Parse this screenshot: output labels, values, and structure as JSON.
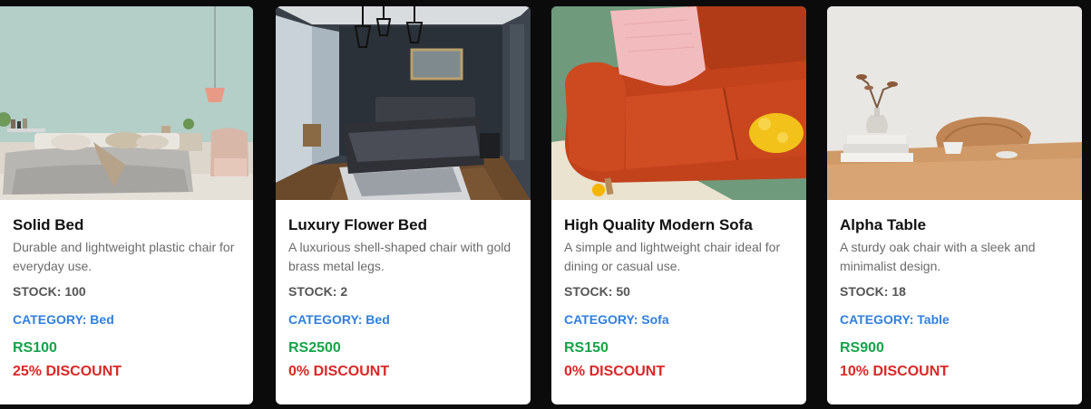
{
  "colors": {
    "page_bg": "#0b0b0b",
    "card_bg": "#ffffff",
    "title": "#111111",
    "description": "#6b6b6b",
    "stock": "#555555",
    "category": "#2f7fde",
    "price": "#16a34a",
    "discount": "#dc2626"
  },
  "products": [
    {
      "name": "Solid Bed",
      "description": "Durable and lightweight plastic chair for everyday use.",
      "stock_label": "STOCK:",
      "stock": "100",
      "category_label": "CATEGORY:",
      "category": "Bed",
      "price": "RS100",
      "discount": "25% DISCOUNT",
      "image": "bedroom-with-grey-bed-photo"
    },
    {
      "name": "Luxury Flower Bed",
      "description": "A luxurious shell-shaped chair with gold brass metal legs.",
      "stock_label": "STOCK:",
      "stock": "2",
      "category_label": "CATEGORY:",
      "category": "Bed",
      "price": "RS2500",
      "discount": "0% DISCOUNT",
      "image": "dark-luxury-bedroom-photo"
    },
    {
      "name": "High Quality Modern Sofa",
      "description": "A simple and lightweight chair ideal for dining or casual use.",
      "stock_label": "STOCK:",
      "stock": "50",
      "category_label": "CATEGORY:",
      "category": "Sofa",
      "price": "RS150",
      "discount": "0% DISCOUNT",
      "image": "orange-sofa-photo"
    },
    {
      "name": "Alpha Table",
      "description": "A sturdy oak chair with a sleek and minimalist design.",
      "stock_label": "STOCK:",
      "stock": "18",
      "category_label": "CATEGORY:",
      "category": "Table",
      "price": "RS900",
      "discount": "10% DISCOUNT",
      "image": "wooden-table-photo"
    }
  ]
}
